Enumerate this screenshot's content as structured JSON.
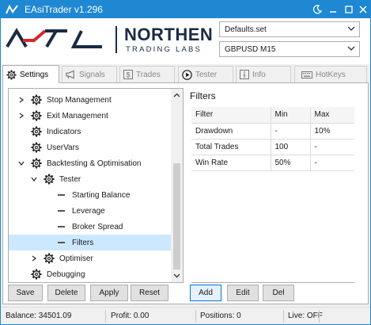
{
  "window": {
    "title": "EAsiTrader v1.296",
    "title_color": "#1e88d2",
    "controls": [
      "moon-icon",
      "minimize-icon",
      "maximize-icon",
      "close-icon"
    ]
  },
  "header": {
    "logo_mark": "NTL",
    "company_name": "NORTHEN",
    "company_sub": "TRADING LABS",
    "logo_color": "#1a2b44",
    "logo_accent": "#d9262c",
    "settings_file": "Defaults.set",
    "symbol_timeframe": "GBPUSD M15"
  },
  "tabs": [
    {
      "label": "Settings",
      "icon": "gear-icon",
      "active": true
    },
    {
      "label": "Signals",
      "icon": "megaphone-icon",
      "active": false
    },
    {
      "label": "Trades",
      "icon": "dollar-icon",
      "active": false
    },
    {
      "label": "Tester",
      "icon": "play-icon",
      "active": false
    },
    {
      "label": "Info",
      "icon": "info-icon",
      "active": false
    },
    {
      "label": "HotKeys",
      "icon": "keyboard-icon",
      "active": false
    }
  ],
  "tree": [
    {
      "label": "Stop Management",
      "level": 0,
      "expander": "collapsed",
      "icon": "gear-icon",
      "selected": false
    },
    {
      "label": "Exit Management",
      "level": 0,
      "expander": "collapsed",
      "icon": "gear-icon",
      "selected": false
    },
    {
      "label": "Indicators",
      "level": 0,
      "expander": "none",
      "icon": "gear-icon",
      "selected": false
    },
    {
      "label": "UserVars",
      "level": 0,
      "expander": "none",
      "icon": "gear-icon",
      "selected": false
    },
    {
      "label": "Backtesting & Optimisation",
      "level": 0,
      "expander": "expanded",
      "icon": "gear-icon",
      "selected": false
    },
    {
      "label": "Tester",
      "level": 1,
      "expander": "expanded",
      "icon": "gear-icon",
      "selected": false
    },
    {
      "label": "Starting Balance",
      "level": 2,
      "expander": "none",
      "icon": "dash",
      "selected": false
    },
    {
      "label": "Leverage",
      "level": 2,
      "expander": "none",
      "icon": "dash",
      "selected": false
    },
    {
      "label": "Broker Spread",
      "level": 2,
      "expander": "none",
      "icon": "dash",
      "selected": false
    },
    {
      "label": "Filters",
      "level": 2,
      "expander": "none",
      "icon": "dash",
      "selected": true
    },
    {
      "label": "Optimiser",
      "level": 1,
      "expander": "collapsed",
      "icon": "gear-icon",
      "selected": false
    },
    {
      "label": "Debugging",
      "level": 0,
      "expander": "none",
      "icon": "gear-icon",
      "selected": false
    }
  ],
  "tree_buttons": [
    "Save",
    "Delete",
    "Apply",
    "Reset"
  ],
  "filters": {
    "title": "Filters",
    "columns": [
      "Filter",
      "Min",
      "Max"
    ],
    "rows": [
      [
        "Drawdown",
        "-",
        "10%"
      ],
      [
        "Total Trades",
        "100",
        "-"
      ],
      [
        "Win Rate",
        "50%",
        "-"
      ]
    ],
    "buttons": [
      "Add",
      "Edit",
      "Del"
    ]
  },
  "status": {
    "balance": "Balance: 34501.09",
    "profit": "Profit: 0.00",
    "positions": "Positions: 0",
    "live": "Live: OFF"
  }
}
